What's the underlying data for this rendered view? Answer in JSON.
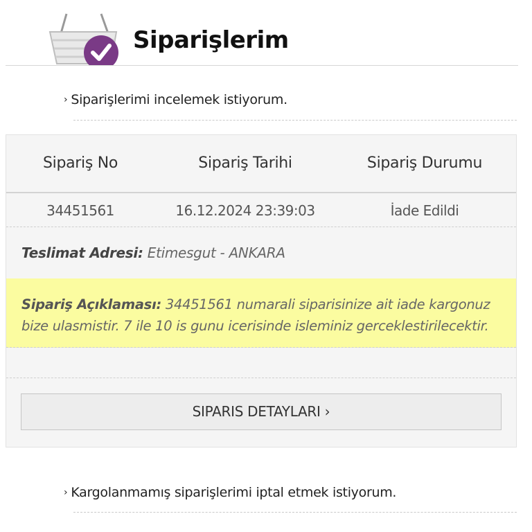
{
  "header": {
    "title": "Siparişlerim",
    "icon": "shopping-basket-check-icon"
  },
  "links": {
    "review_orders": "Siparişlerimi incelemek istiyorum.",
    "cancel_orders": "Kargolanmamış siparişlerimi iptal etmek istiyorum.",
    "chevron": "›"
  },
  "order_table": {
    "columns": [
      "Sipariş No",
      "Sipariş Tarihi",
      "Sipariş Durumu"
    ],
    "rows": [
      {
        "order_no": "34451561",
        "order_date": "16.12.2024 23:39:03",
        "status": "İade Edildi"
      }
    ]
  },
  "delivery": {
    "label": "Teslimat Adresi:",
    "value": "Etimesgut - ANKARA"
  },
  "description": {
    "label": "Sipariş Açıklaması:",
    "text": "34451561 numarali siparisinize ait iade kargonuz bize ulasmistir. 7 ile 10 is gunu icerisinde isleminiz gerceklestirilecektir.",
    "bg_color": "#fbfca0"
  },
  "detail_button": {
    "label": "SIPARIS DETAYLARI ›"
  }
}
